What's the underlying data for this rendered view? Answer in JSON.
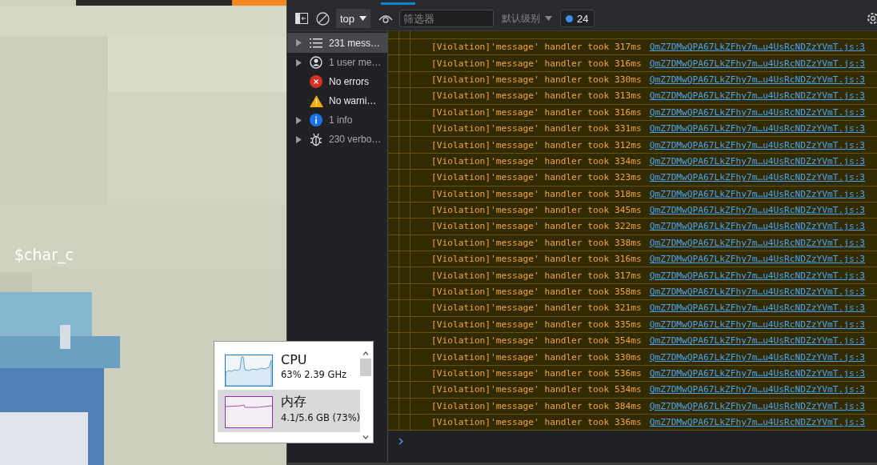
{
  "game": {
    "label": "$char_c"
  },
  "devtools": {
    "toolbar": {
      "context": "top",
      "filter_placeholder": "筛选器",
      "levels": "默认级别",
      "issues_count": "24"
    },
    "sidebar": [
      {
        "kind": "messages",
        "label": "231 mess…",
        "expandable": true,
        "selected": true
      },
      {
        "kind": "user",
        "label": "1 user me…",
        "expandable": true,
        "selected": false
      },
      {
        "kind": "errors",
        "label": "No errors",
        "expandable": false,
        "selected": false
      },
      {
        "kind": "warnings",
        "label": "No warni…",
        "expandable": false,
        "selected": false
      },
      {
        "kind": "info",
        "label": "1 info",
        "expandable": true,
        "selected": false
      },
      {
        "kind": "verbose",
        "label": "230 verbo…",
        "expandable": true,
        "selected": false
      }
    ],
    "console": {
      "rows": [
        {
          "message": "[Violation]'message' handler took 317ms",
          "source": "QmZ7DMwQPA67LkZFhy7m…u4UsRcNDZzYVmT.js:3"
        },
        {
          "message": "[Violation]'message' handler took 316ms",
          "source": "QmZ7DMwQPA67LkZFhy7m…u4UsRcNDZzYVmT.js:3"
        },
        {
          "message": "[Violation]'message' handler took 330ms",
          "source": "QmZ7DMwQPA67LkZFhy7m…u4UsRcNDZzYVmT.js:3"
        },
        {
          "message": "[Violation]'message' handler took 313ms",
          "source": "QmZ7DMwQPA67LkZFhy7m…u4UsRcNDZzYVmT.js:3"
        },
        {
          "message": "[Violation]'message' handler took 316ms",
          "source": "QmZ7DMwQPA67LkZFhy7m…u4UsRcNDZzYVmT.js:3"
        },
        {
          "message": "[Violation]'message' handler took 331ms",
          "source": "QmZ7DMwQPA67LkZFhy7m…u4UsRcNDZzYVmT.js:3"
        },
        {
          "message": "[Violation]'message' handler took 312ms",
          "source": "QmZ7DMwQPA67LkZFhy7m…u4UsRcNDZzYVmT.js:3"
        },
        {
          "message": "[Violation]'message' handler took 334ms",
          "source": "QmZ7DMwQPA67LkZFhy7m…u4UsRcNDZzYVmT.js:3"
        },
        {
          "message": "[Violation]'message' handler took 323ms",
          "source": "QmZ7DMwQPA67LkZFhy7m…u4UsRcNDZzYVmT.js:3"
        },
        {
          "message": "[Violation]'message' handler took 318ms",
          "source": "QmZ7DMwQPA67LkZFhy7m…u4UsRcNDZzYVmT.js:3"
        },
        {
          "message": "[Violation]'message' handler took 345ms",
          "source": "QmZ7DMwQPA67LkZFhy7m…u4UsRcNDZzYVmT.js:3"
        },
        {
          "message": "[Violation]'message' handler took 322ms",
          "source": "QmZ7DMwQPA67LkZFhy7m…u4UsRcNDZzYVmT.js:3"
        },
        {
          "message": "[Violation]'message' handler took 338ms",
          "source": "QmZ7DMwQPA67LkZFhy7m…u4UsRcNDZzYVmT.js:3"
        },
        {
          "message": "[Violation]'message' handler took 316ms",
          "source": "QmZ7DMwQPA67LkZFhy7m…u4UsRcNDZzYVmT.js:3"
        },
        {
          "message": "[Violation]'message' handler took 317ms",
          "source": "QmZ7DMwQPA67LkZFhy7m…u4UsRcNDZzYVmT.js:3"
        },
        {
          "message": "[Violation]'message' handler took 358ms",
          "source": "QmZ7DMwQPA67LkZFhy7m…u4UsRcNDZzYVmT.js:3"
        },
        {
          "message": "[Violation]'message' handler took 321ms",
          "source": "QmZ7DMwQPA67LkZFhy7m…u4UsRcNDZzYVmT.js:3"
        },
        {
          "message": "[Violation]'message' handler took 335ms",
          "source": "QmZ7DMwQPA67LkZFhy7m…u4UsRcNDZzYVmT.js:3"
        },
        {
          "message": "[Violation]'message' handler took 354ms",
          "source": "QmZ7DMwQPA67LkZFhy7m…u4UsRcNDZzYVmT.js:3"
        },
        {
          "message": "[Violation]'message' handler took 330ms",
          "source": "QmZ7DMwQPA67LkZFhy7m…u4UsRcNDZzYVmT.js:3"
        },
        {
          "message": "[Violation]'message' handler took 536ms",
          "source": "QmZ7DMwQPA67LkZFhy7m…u4UsRcNDZzYVmT.js:3"
        },
        {
          "message": "[Violation]'message' handler took 534ms",
          "source": "QmZ7DMwQPA67LkZFhy7m…u4UsRcNDZzYVmT.js:3"
        },
        {
          "message": "[Violation]'message' handler took 384ms",
          "source": "QmZ7DMwQPA67LkZFhy7m…u4UsRcNDZzYVmT.js:3"
        },
        {
          "message": "[Violation]'message' handler took 336ms",
          "source": "QmZ7DMwQPA67LkZFhy7m…u4UsRcNDZzYVmT.js:3"
        }
      ]
    }
  },
  "task_manager": {
    "items": [
      {
        "kind": "cpu",
        "name": "CPU",
        "detail": "63%  2.39 GHz",
        "selected": false
      },
      {
        "kind": "memory",
        "name": "内存",
        "detail": "4.1/5.6 GB (73%)",
        "selected": true
      }
    ]
  }
}
